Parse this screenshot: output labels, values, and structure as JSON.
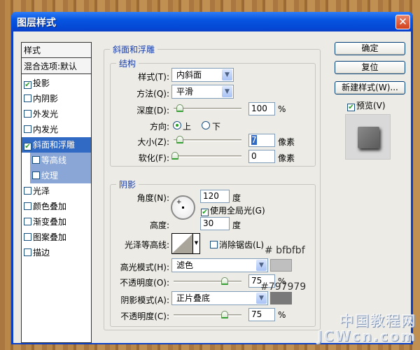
{
  "window": {
    "title": "图层样式",
    "close_icon": "close-icon"
  },
  "sidebar": {
    "header": "样式",
    "blend": "混合选项:默认",
    "items": [
      {
        "label": "投影",
        "checked": true
      },
      {
        "label": "内阴影",
        "checked": false
      },
      {
        "label": "外发光",
        "checked": false
      },
      {
        "label": "内发光",
        "checked": false
      },
      {
        "label": "斜面和浮雕",
        "checked": true,
        "selected": true
      },
      {
        "label": "等高线",
        "checked": false,
        "sub": true
      },
      {
        "label": "纹理",
        "checked": false,
        "sub": true
      },
      {
        "label": "光泽",
        "checked": false
      },
      {
        "label": "颜色叠加",
        "checked": false
      },
      {
        "label": "渐变叠加",
        "checked": false
      },
      {
        "label": "图案叠加",
        "checked": false
      },
      {
        "label": "描边",
        "checked": false
      }
    ]
  },
  "bevel": {
    "title": "斜面和浮雕",
    "structure": {
      "title": "结构",
      "style_label": "样式(T):",
      "style_value": "内斜面",
      "technique_label": "方法(Q):",
      "technique_value": "平滑",
      "depth_label": "深度(D):",
      "depth_value": "100",
      "depth_unit": "%",
      "depth_slider_pct": 0.1,
      "direction_label": "方向:",
      "dir_up": "上",
      "dir_down": "下",
      "direction_selected": "上",
      "size_label": "大小(Z):",
      "size_value": "7",
      "size_unit": "像素",
      "size_slider_pct": 0.05,
      "soften_label": "软化(F):",
      "soften_value": "0",
      "soften_unit": "像素",
      "soften_slider_pct": 0
    },
    "shading": {
      "title": "阴影",
      "angle_label": "角度(N):",
      "angle_value": "120",
      "angle_unit": "度",
      "global_light_label": "使用全局光(G)",
      "global_light_checked": true,
      "altitude_label": "高度:",
      "altitude_value": "30",
      "altitude_unit": "度",
      "gloss_label": "光泽等高线:",
      "antialias_label": "消除锯齿(L)",
      "antialias_checked": false,
      "highlight_label": "高光模式(H):",
      "highlight_mode": "滤色",
      "highlight_color": "#bfbfbf",
      "highlight_annot": "# bfbfbf",
      "hl_opacity_label": "不透明度(O):",
      "hl_opacity_value": "75",
      "hl_opacity_unit": "%",
      "hl_opacity_pct": 0.75,
      "shadow_label": "阴影模式(A):",
      "shadow_mode": "正片叠底",
      "shadow_color": "#797979",
      "shadow_annot": "#797979",
      "sh_opacity_label": "不透明度(C):",
      "sh_opacity_value": "75",
      "sh_opacity_unit": "%",
      "sh_opacity_pct": 0.75
    }
  },
  "buttons": {
    "ok": "确定",
    "reset": "复位",
    "new_style": "新建样式(W)...",
    "preview": "预览(V)",
    "preview_checked": true
  },
  "watermark": "中国教程网 JCWcn.com"
}
